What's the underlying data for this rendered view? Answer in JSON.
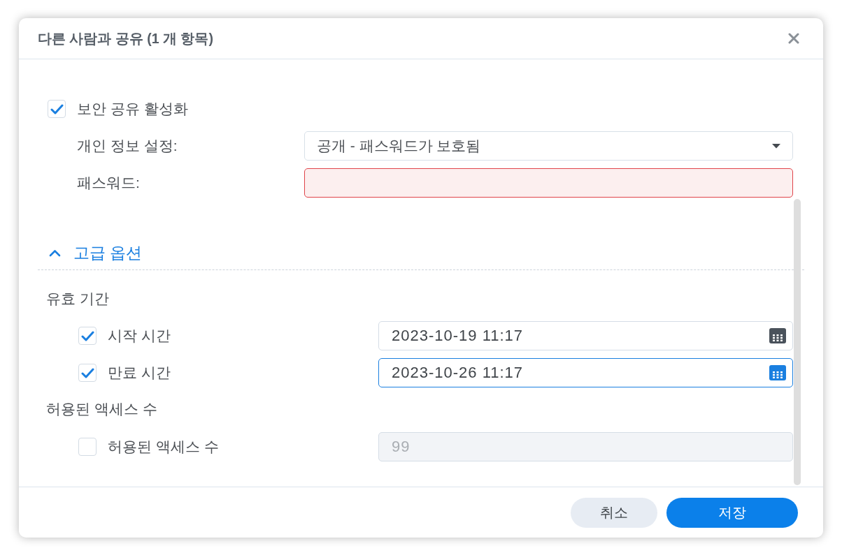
{
  "dialog": {
    "title": "다른 사람과 공유 (1 개 항목)"
  },
  "secure_share": {
    "label": "보안 공유 활성화",
    "checked": true
  },
  "privacy": {
    "label": "개인 정보 설정:",
    "value": "공개 - 패스워드가 보호됨"
  },
  "password": {
    "label": "패스워드:",
    "invalid": true
  },
  "advanced": {
    "label": "고급 옵션",
    "expanded": true
  },
  "sections": [
    {
      "heading": "유효 기간",
      "options": [
        {
          "kind": "datetime",
          "label": "시작 시간",
          "checked": true,
          "value": "2023-10-19 11:17",
          "focused": false,
          "disabled": false
        },
        {
          "kind": "datetime",
          "label": "만료 시간",
          "checked": true,
          "value": "2023-10-26 11:17",
          "focused": true,
          "disabled": false
        }
      ]
    },
    {
      "heading": "허용된 액세스 수",
      "options": [
        {
          "kind": "number",
          "label": "허용된 액세스 수",
          "checked": false,
          "value": "99",
          "focused": false,
          "disabled": true
        }
      ]
    }
  ],
  "buttons": [
    {
      "label": "취소",
      "kind": "secondary"
    },
    {
      "label": "저장",
      "kind": "primary"
    }
  ]
}
